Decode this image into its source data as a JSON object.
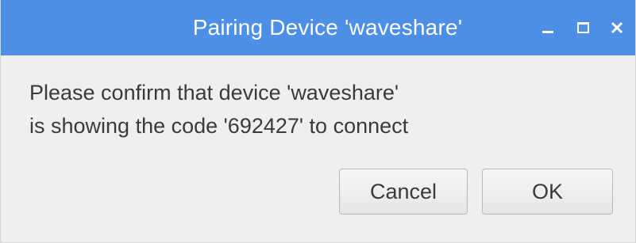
{
  "window": {
    "title": "Pairing Device 'waveshare'",
    "controls": {
      "minimize_icon": "minimize-icon",
      "maximize_icon": "maximize-icon",
      "close_icon": "close-icon"
    },
    "accent_color": "#4d8ee6"
  },
  "dialog": {
    "message_line_1": "Please confirm that device 'waveshare'",
    "message_line_2": "is showing the code '692427' to connect"
  },
  "buttons": {
    "cancel_label": "Cancel",
    "ok_label": "OK"
  }
}
